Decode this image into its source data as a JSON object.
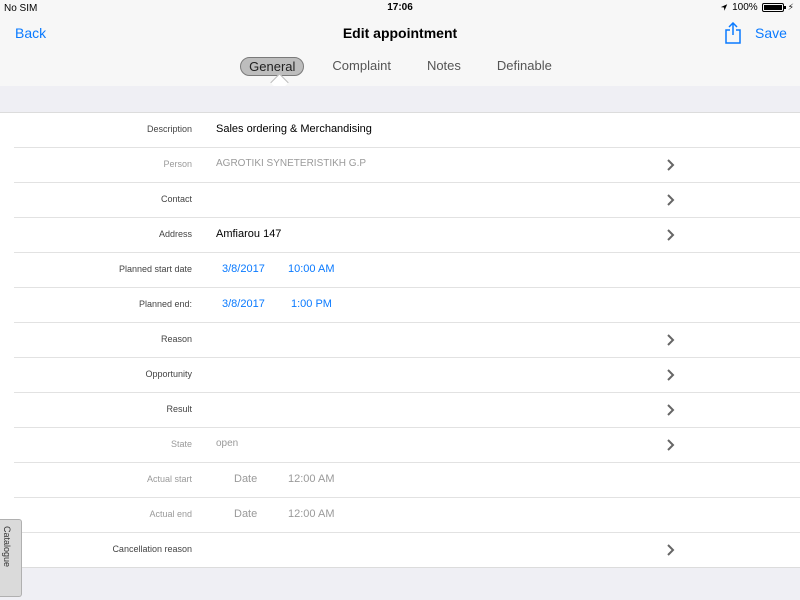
{
  "status_bar": {
    "carrier": "No SIM",
    "time": "17:06",
    "battery": "100%"
  },
  "nav": {
    "back_label": "Back",
    "title": "Edit appointment",
    "save_label": "Save"
  },
  "tabs": [
    {
      "label": "General",
      "active": true
    },
    {
      "label": "Complaint",
      "active": false
    },
    {
      "label": "Notes",
      "active": false
    },
    {
      "label": "Definable",
      "active": false
    }
  ],
  "form": {
    "description": {
      "label": "Description",
      "value": "Sales ordering & Merchandising"
    },
    "person": {
      "label": "Person",
      "value": "AGROTIKI SYNETERISTIKH G.P"
    },
    "contact": {
      "label": "Contact",
      "value": ""
    },
    "address": {
      "label": "Address",
      "value": "Amfiarou 147"
    },
    "planned_start": {
      "label": "Planned start date",
      "date": "3/8/2017",
      "time": "10:00 AM"
    },
    "planned_end": {
      "label": "Planned end:",
      "date": "3/8/2017",
      "time": "1:00 PM"
    },
    "reason": {
      "label": "Reason",
      "value": ""
    },
    "opportunity": {
      "label": "Opportunity",
      "value": ""
    },
    "result": {
      "label": "Result",
      "value": ""
    },
    "state": {
      "label": "State",
      "value": "open"
    },
    "actual_start": {
      "label": "Actual start",
      "date": "Date",
      "time": "12:00 AM"
    },
    "actual_end": {
      "label": "Actual end",
      "date": "Date",
      "time": "12:00 AM"
    },
    "cancellation_reason": {
      "label": "Cancellation reason",
      "value": ""
    }
  },
  "side_tab": {
    "label": "Catalogue"
  },
  "colors": {
    "accent": "#0a7aff",
    "background": "#efeff4",
    "disabled_text": "#9a9a9a"
  }
}
